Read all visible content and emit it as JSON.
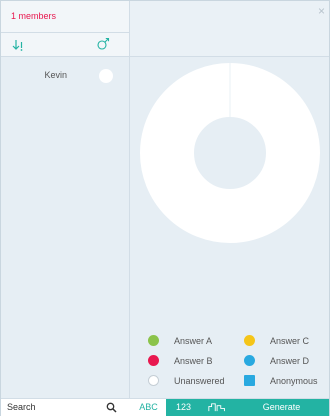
{
  "sidebar": {
    "members_label": "1 members",
    "students": [
      {
        "name": "Kevin"
      }
    ]
  },
  "main": {
    "close_glyph": "×",
    "legend": [
      {
        "label": "Answer A",
        "color": "#8bc34a",
        "shape": "circle"
      },
      {
        "label": "Answer C",
        "color": "#f5c518",
        "shape": "circle"
      },
      {
        "label": "Answer B",
        "color": "#e8184f",
        "shape": "circle"
      },
      {
        "label": "Answer D",
        "color": "#29a9e0",
        "shape": "circle"
      },
      {
        "label": "Unanswered",
        "color": "#ffffff",
        "shape": "circle"
      },
      {
        "label": "Anonymous",
        "color": "#29a9e0",
        "shape": "square"
      }
    ]
  },
  "footer": {
    "search_placeholder": "Search",
    "abc_label": "ABC",
    "num_label": "123",
    "generate_label": "Generate"
  },
  "colors": {
    "accent": "#23b3a3",
    "members": "#e8184f"
  },
  "icons": [
    "sort-icon",
    "gender-icon",
    "close-icon",
    "search-icon",
    "group-icon"
  ]
}
